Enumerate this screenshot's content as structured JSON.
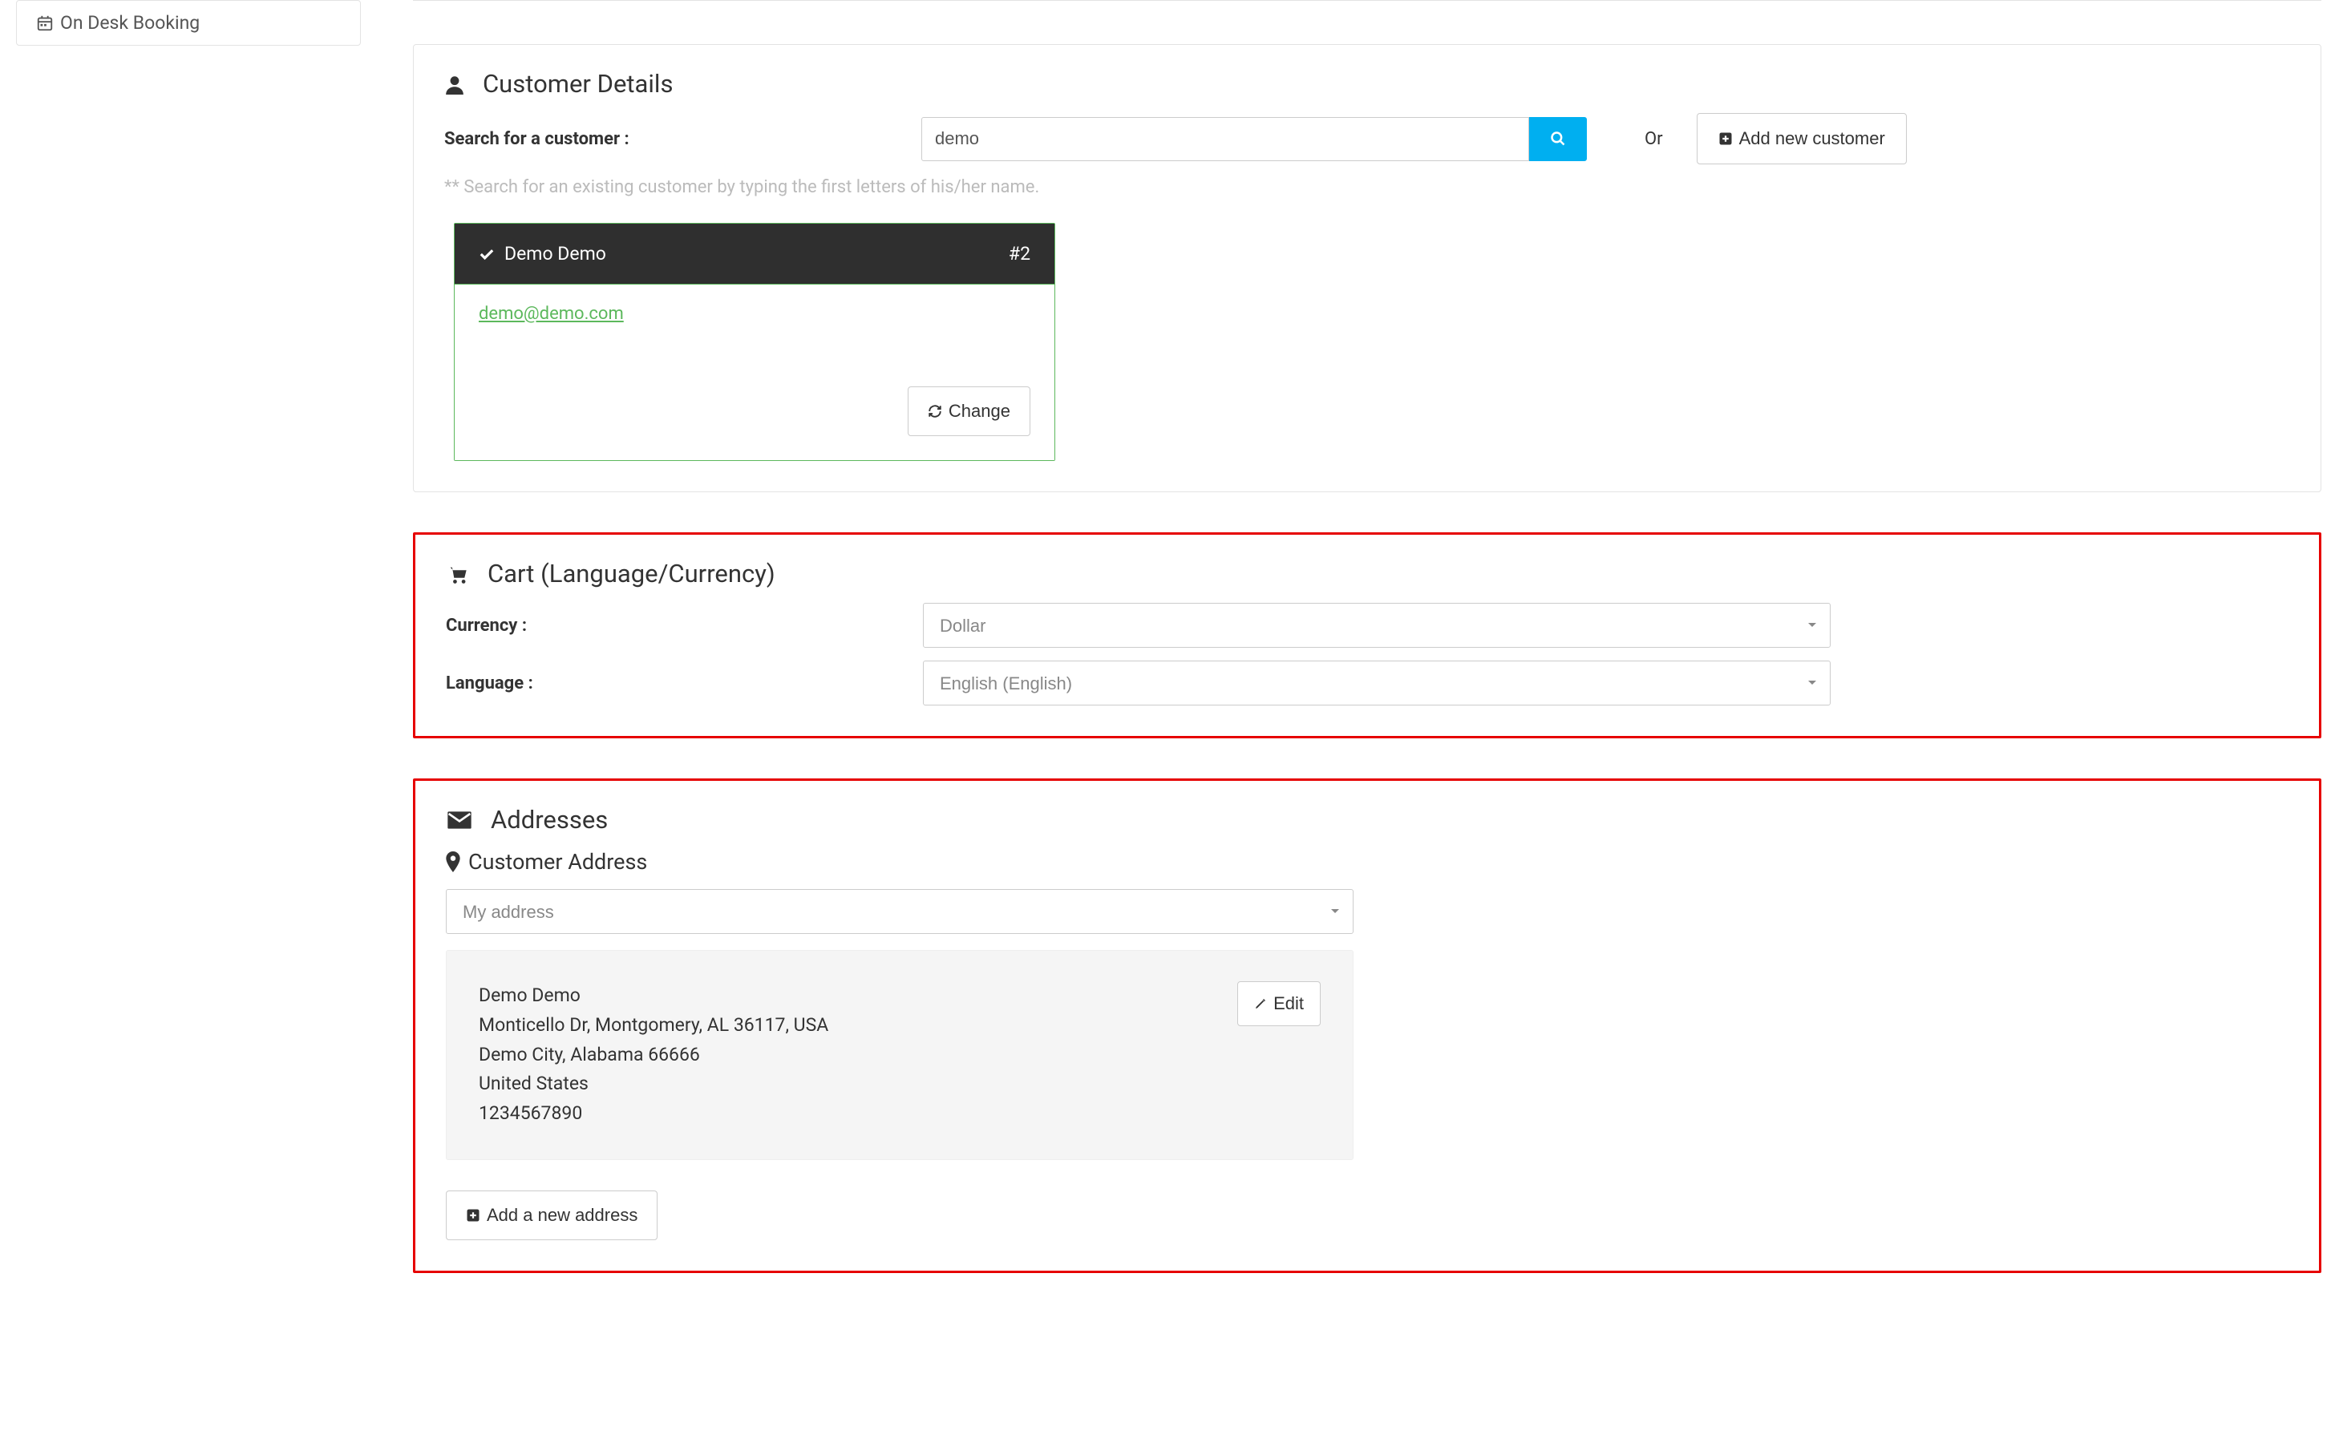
{
  "sidebar": {
    "desk_booking_label": "On Desk Booking"
  },
  "customer": {
    "title": "Customer Details",
    "search_label": "Search for a customer :",
    "search_value": "demo",
    "or_label": "Or",
    "add_new_label": "Add new customer",
    "hint": "** Search for an existing customer by typing the first letters of his/her name.",
    "selected": {
      "name": "Demo Demo",
      "id_label": "#2",
      "email": "demo@demo.com",
      "change_label": "Change"
    }
  },
  "cart": {
    "title": "Cart (Language/Currency)",
    "currency_label": "Currency :",
    "currency_value": "Dollar",
    "language_label": "Language :",
    "language_value": "English (English)"
  },
  "addresses": {
    "title": "Addresses",
    "subtitle": "Customer Address",
    "selected_option": "My address",
    "lines": {
      "l1": "Demo Demo",
      "l2": "Monticello Dr, Montgomery, AL 36117, USA",
      "l3": "Demo City, Alabama 66666",
      "l4": "United States",
      "l5": "1234567890"
    },
    "edit_label": "Edit",
    "add_new_label": "Add a new address"
  }
}
